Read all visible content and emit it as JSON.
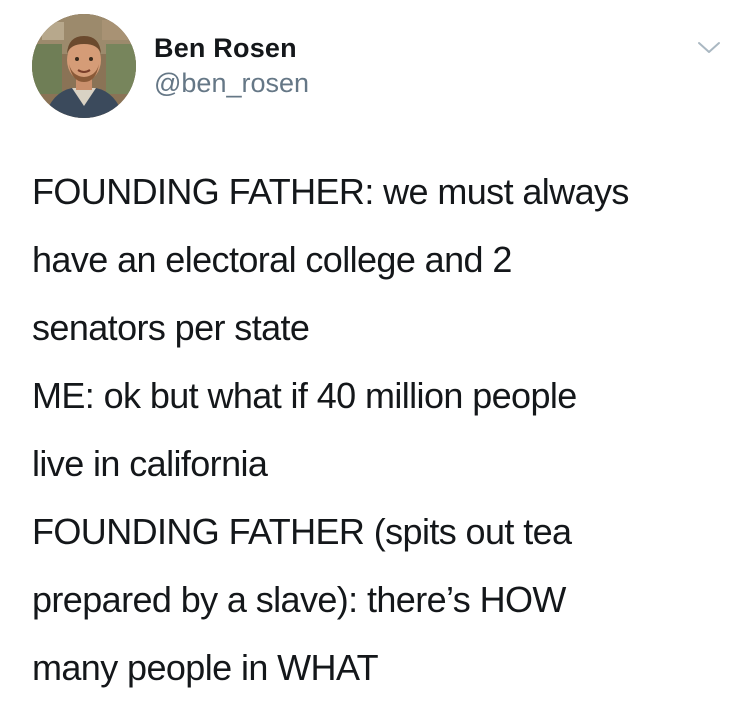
{
  "user": {
    "display_name": "Ben Rosen",
    "handle": "@ben_rosen"
  },
  "icons": {
    "menu": "chevron-down-icon",
    "avatar": "profile-photo"
  },
  "tweet": {
    "paragraphs": [
      "FOUNDING FATHER: we must always\nhave an electoral college and 2\nsenators per state",
      "ME: ok but what if 40 million people\nlive in california",
      "FOUNDING FATHER (spits out tea\nprepared by a slave): there’s HOW\nmany people in WHAT"
    ]
  },
  "colors": {
    "text": "#14171a",
    "secondary": "#657786",
    "caret": "#aab8c2"
  }
}
